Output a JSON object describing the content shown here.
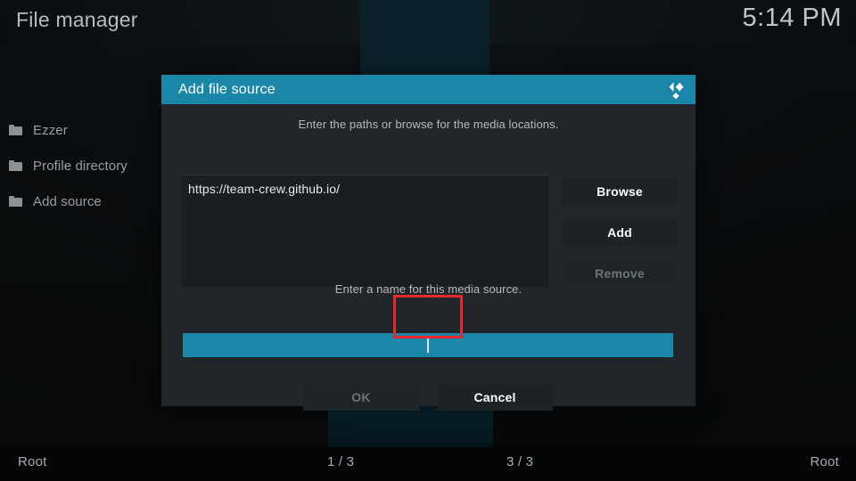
{
  "window": {
    "title": "File manager",
    "clock": "5:14 PM"
  },
  "sidebar": {
    "items": [
      {
        "label": "Ezzer",
        "icon": "folder-icon"
      },
      {
        "label": "Profile directory",
        "icon": "folder-icon"
      },
      {
        "label": "Add source",
        "icon": "folder-icon"
      }
    ]
  },
  "dialog": {
    "title": "Add file source",
    "logo_icon": "kodi-logo-icon",
    "hint_paths": "Enter the paths or browse for the media locations.",
    "hint_name": "Enter a name for this media source.",
    "paths": [
      {
        "value": "https://team-crew.github.io/"
      }
    ],
    "side_buttons": [
      {
        "label": "Browse",
        "disabled": false
      },
      {
        "label": "Add",
        "disabled": false
      },
      {
        "label": "Remove",
        "disabled": true
      }
    ],
    "name_field": {
      "value": "",
      "placeholder": "",
      "focused": true,
      "caret_visible": true
    },
    "actions": [
      {
        "label": "OK",
        "disabled": true
      },
      {
        "label": "Cancel",
        "disabled": false
      }
    ]
  },
  "footer": {
    "left_label": "Root",
    "left_count": "1 / 3",
    "right_count": "3 / 3",
    "right_label": "Root"
  },
  "colors": {
    "accent": "#1b87a8",
    "dialog_body": "#21262a",
    "button": "#1d2225",
    "disabled_text": "#6d7477",
    "annotation": "#e8272c",
    "text": "#ffffff"
  }
}
